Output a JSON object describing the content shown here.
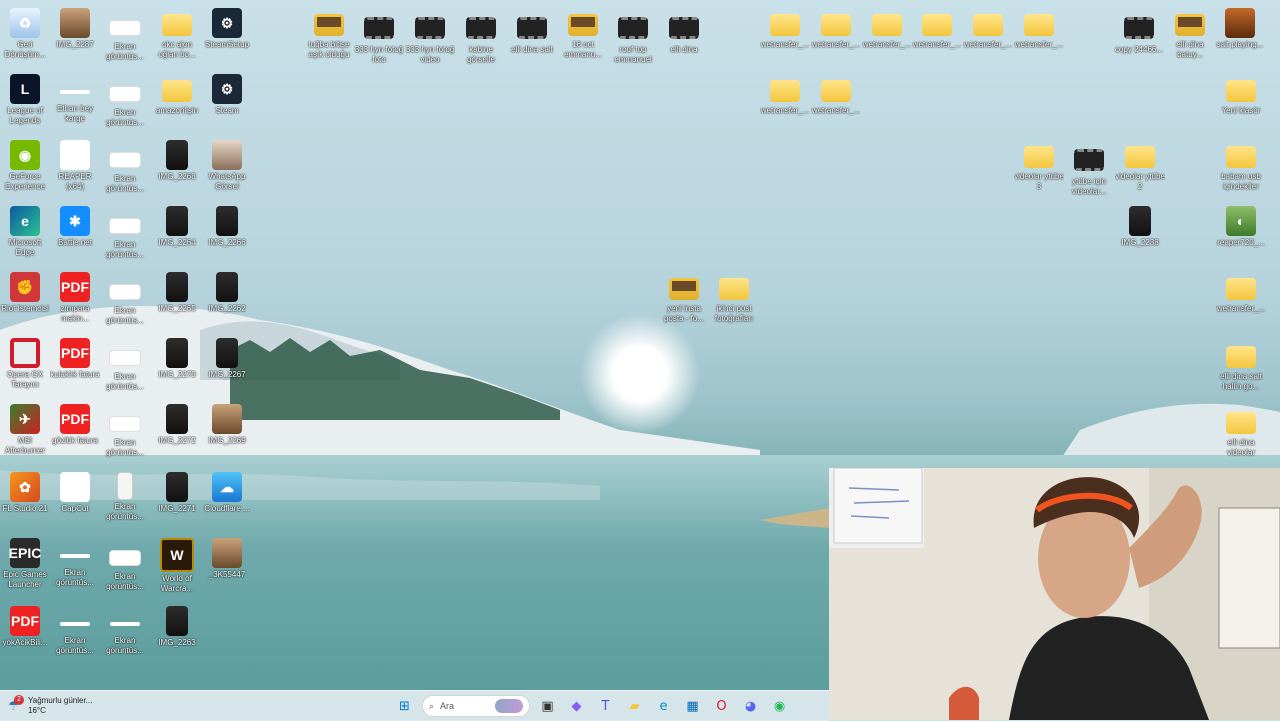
{
  "desktop": {
    "icons": [
      {
        "label": "Geri Dönüşüm...",
        "icon": "recycle-bin-icon",
        "style": "g-recycle",
        "glyph": "♻"
      },
      {
        "label": "IMG_2287",
        "icon": "photo-file-icon",
        "style": "g-person",
        "glyph": ""
      },
      {
        "label": "Ekran görüntüs...",
        "icon": "screenshot-file-icon",
        "style": "g-screen",
        "glyph": ""
      },
      {
        "label": "okc ajon oğlan bo...",
        "icon": "folder-icon",
        "style": "g-folder",
        "glyph": ""
      },
      {
        "label": "SteamSetup",
        "icon": "steam-icon",
        "style": "g-steam",
        "glyph": "⚙"
      },
      {
        "label": "League of Legends",
        "icon": "league-of-legends-icon",
        "style": "g-lol",
        "glyph": "L"
      },
      {
        "label": "Ethan bey karge",
        "icon": "screenshot-file-icon",
        "style": "g-strip",
        "glyph": ""
      },
      {
        "label": "Ekran görüntüs...",
        "icon": "screenshot-file-icon",
        "style": "g-screen",
        "glyph": ""
      },
      {
        "label": "amazonlişin",
        "icon": "folder-icon",
        "style": "g-folder",
        "glyph": ""
      },
      {
        "label": "Steam",
        "icon": "steam-icon",
        "style": "g-steam",
        "glyph": "⚙"
      },
      {
        "label": "GeForce Experience",
        "icon": "nvidia-icon",
        "style": "g-nvidia",
        "glyph": "◉"
      },
      {
        "label": "REAPER (x64)",
        "icon": "reaper-icon",
        "style": "g-reaper",
        "glyph": "◐"
      },
      {
        "label": "Ekran görüntüs...",
        "icon": "screenshot-file-icon",
        "style": "g-screen",
        "glyph": ""
      },
      {
        "label": "IMG_2268",
        "icon": "photo-file-icon",
        "style": "g-photo",
        "glyph": ""
      },
      {
        "label": "WhatsApp Görsel 2023...",
        "icon": "photo-file-icon",
        "style": "g-wa",
        "glyph": ""
      },
      {
        "label": "Microsoft Edge",
        "icon": "edge-icon",
        "style": "g-edge",
        "glyph": "e"
      },
      {
        "label": "Battle.net",
        "icon": "battlenet-icon",
        "style": "g-bnet",
        "glyph": "✱"
      },
      {
        "label": "Ekran görüntüs...",
        "icon": "screenshot-file-icon",
        "style": "g-screen",
        "glyph": ""
      },
      {
        "label": "IMG_2264",
        "icon": "photo-file-icon",
        "style": "g-photo",
        "glyph": ""
      },
      {
        "label": "IMG_2266",
        "icon": "photo-file-icon",
        "style": "g-photo",
        "glyph": ""
      },
      {
        "label": "Riot İstemcisi",
        "icon": "riot-icon",
        "style": "g-riot",
        "glyph": "✊"
      },
      {
        "label": "zımpara makin...",
        "icon": "pdf-file-icon",
        "style": "g-pdf",
        "glyph": "PDF"
      },
      {
        "label": "Ekran görüntüs...",
        "icon": "screenshot-file-icon",
        "style": "g-screen",
        "glyph": ""
      },
      {
        "label": "IMG_2265",
        "icon": "photo-file-icon",
        "style": "g-photo",
        "glyph": ""
      },
      {
        "label": "IMG_2262",
        "icon": "photo-file-icon",
        "style": "g-photo",
        "glyph": ""
      },
      {
        "label": "Opera GX Tarayıcı",
        "icon": "opera-gx-icon",
        "style": "g-opera",
        "glyph": ""
      },
      {
        "label": "kulaklık fatura",
        "icon": "pdf-file-icon",
        "style": "g-pdf",
        "glyph": "PDF"
      },
      {
        "label": "Ekran görüntüs...",
        "icon": "screenshot-file-icon",
        "style": "g-screen",
        "glyph": ""
      },
      {
        "label": "IMG_2270",
        "icon": "photo-file-icon",
        "style": "g-photo",
        "glyph": ""
      },
      {
        "label": "IMG_2267",
        "icon": "photo-file-icon",
        "style": "g-photo",
        "glyph": ""
      },
      {
        "label": "MSI Afterburner",
        "icon": "msi-afterburner-icon",
        "style": "g-msi",
        "glyph": "✈"
      },
      {
        "label": "gözlük fatura",
        "icon": "pdf-file-icon",
        "style": "g-pdf",
        "glyph": "PDF"
      },
      {
        "label": "Ekran görüntüs...",
        "icon": "screenshot-file-icon",
        "style": "g-screen",
        "glyph": ""
      },
      {
        "label": "IMG_2272",
        "icon": "photo-file-icon",
        "style": "g-photo",
        "glyph": ""
      },
      {
        "label": "IMG_2269",
        "icon": "photo-file-icon",
        "style": "g-person",
        "glyph": ""
      },
      {
        "label": "FL Studio 21",
        "icon": "fl-studio-icon",
        "style": "g-fl",
        "glyph": "✿"
      },
      {
        "label": "CapCut",
        "icon": "capcut-icon",
        "style": "g-capcut",
        "glyph": "✂"
      },
      {
        "label": "Ekran görüntüs...",
        "icon": "screenshot-file-icon",
        "style": "g-file",
        "glyph": ""
      },
      {
        "label": "IMG_2271",
        "icon": "photo-file-icon",
        "style": "g-photo",
        "glyph": ""
      },
      {
        "label": "Cloudflare ...",
        "icon": "cloudflare-icon",
        "style": "g-cloud",
        "glyph": "☁"
      },
      {
        "label": "Epic Games Launcher",
        "icon": "epic-games-icon",
        "style": "g-epic",
        "glyph": "EPIC"
      },
      {
        "label": "Ekran görüntüs...",
        "icon": "screenshot-file-icon",
        "style": "g-strip",
        "glyph": ""
      },
      {
        "label": "Ekran görüntüs...",
        "icon": "screenshot-file-icon",
        "style": "g-screen",
        "glyph": ""
      },
      {
        "label": "World of Warcra...",
        "icon": "world-of-warcraft-icon",
        "style": "g-wow",
        "glyph": "W"
      },
      {
        "label": "_3K55447",
        "icon": "photo-file-icon",
        "style": "g-person",
        "glyph": ""
      },
      {
        "label": "yokAcikBili...",
        "icon": "pdf-file-icon",
        "style": "g-pdf",
        "glyph": "PDF"
      },
      {
        "label": "Ekran görüntüs...",
        "icon": "screenshot-file-icon",
        "style": "g-strip",
        "glyph": ""
      },
      {
        "label": "Ekran görüntüs...",
        "icon": "screenshot-file-icon",
        "style": "g-strip",
        "glyph": ""
      },
      {
        "label": "IMG_2263",
        "icon": "photo-file-icon",
        "style": "g-photo",
        "glyph": ""
      },
      {
        "label": "tuğba bitişe aşık olduğu",
        "icon": "video-folder-icon",
        "style": "g-folderimg",
        "glyph": ""
      },
      {
        "label": "333 hyn fotoğ foto",
        "icon": "video-folder-icon",
        "style": "g-film",
        "glyph": ""
      },
      {
        "label": "333 hyn fotoğ video",
        "icon": "video-folder-icon",
        "style": "g-film",
        "glyph": ""
      },
      {
        "label": "kabine görselle",
        "icon": "video-folder-icon",
        "style": "g-film",
        "glyph": ""
      },
      {
        "label": "elli dina salt",
        "icon": "video-folder-icon",
        "style": "g-film",
        "glyph": ""
      },
      {
        "label": "16 oct emmanu...",
        "icon": "video-folder-icon",
        "style": "g-folderimg",
        "glyph": ""
      },
      {
        "label": "roof top emmanuel",
        "icon": "video-folder-icon",
        "style": "g-film",
        "glyph": ""
      },
      {
        "label": "elli dina",
        "icon": "video-folder-icon",
        "style": "g-film",
        "glyph": ""
      },
      {
        "label": "wetransfer_...",
        "icon": "zip-folder-icon",
        "style": "g-folder",
        "glyph": ""
      },
      {
        "label": "wetransfer_...",
        "icon": "zip-folder-icon",
        "style": "g-folder",
        "glyph": ""
      },
      {
        "label": "wetransfer_...",
        "icon": "zip-folder-icon",
        "style": "g-folder",
        "glyph": ""
      },
      {
        "label": "wetransfer_...",
        "icon": "zip-folder-icon",
        "style": "g-folder",
        "glyph": ""
      },
      {
        "label": "wetransfer_...",
        "icon": "zip-folder-icon",
        "style": "g-folder",
        "glyph": ""
      },
      {
        "label": "wetransfer_...",
        "icon": "zip-folder-icon",
        "style": "g-folder",
        "glyph": ""
      },
      {
        "label": "wetransfer_...",
        "icon": "zip-folder-icon",
        "style": "g-folder",
        "glyph": ""
      },
      {
        "label": "wetransfer_...",
        "icon": "zip-folder-icon",
        "style": "g-folder",
        "glyph": ""
      },
      {
        "label": "copy 24466...",
        "icon": "video-file-icon",
        "style": "g-film",
        "glyph": ""
      },
      {
        "label": "elli dina batuy...",
        "icon": "video-folder-icon",
        "style": "g-folderimg",
        "glyph": ""
      },
      {
        "label": "salt playing...",
        "icon": "photo-file-icon",
        "style": "g-game",
        "glyph": ""
      },
      {
        "label": "Yeni klasör",
        "icon": "folder-icon",
        "style": "g-folder",
        "glyph": ""
      },
      {
        "label": "videolar ytübe 3",
        "icon": "folder-icon",
        "style": "g-folder",
        "glyph": ""
      },
      {
        "label": "ytübe için videolar...",
        "icon": "video-folder-icon",
        "style": "g-film",
        "glyph": ""
      },
      {
        "label": "videolar ytübe 2",
        "icon": "folder-icon",
        "style": "g-folder",
        "glyph": ""
      },
      {
        "label": "babam usb içindekiler",
        "icon": "folder-icon",
        "style": "g-folder",
        "glyph": ""
      },
      {
        "label": "IMG_2238",
        "icon": "photo-file-icon",
        "style": "g-photo",
        "glyph": ""
      },
      {
        "label": "reaper720_...",
        "icon": "archive-file-icon",
        "style": "g-rar",
        "glyph": "◐"
      },
      {
        "label": "yeni insta posta - fo...",
        "icon": "video-folder-icon",
        "style": "g-folderimg",
        "glyph": ""
      },
      {
        "label": "ikinci post fotoğrafları",
        "icon": "folder-icon",
        "style": "g-folder",
        "glyph": ""
      },
      {
        "label": "wetransfer_...",
        "icon": "zip-folder-icon",
        "style": "g-folder",
        "glyph": ""
      },
      {
        "label": "elli dina salt hallin go...",
        "icon": "zip-folder-icon",
        "style": "g-folder",
        "glyph": ""
      },
      {
        "label": "elli dina videolar",
        "icon": "zip-folder-icon",
        "style": "g-folder",
        "glyph": ""
      }
    ]
  },
  "taskbar": {
    "weather": {
      "title": "Yağmurlu günler...",
      "temp": "16°C",
      "badge": "2"
    },
    "search_placeholder": "Ara",
    "apps": [
      {
        "name": "start-button",
        "icon": "windows-icon",
        "glyph": "⊞",
        "color": "#0078d4"
      },
      {
        "name": "task-view-button",
        "icon": "task-view-icon",
        "glyph": "▣",
        "color": "#333333"
      },
      {
        "name": "copilot-button",
        "icon": "copilot-icon",
        "glyph": "◆",
        "color": "#8a5cf6"
      },
      {
        "name": "teams-button",
        "icon": "teams-icon",
        "glyph": "T",
        "color": "#5059c9"
      },
      {
        "name": "file-explorer-button",
        "icon": "folder-icon",
        "glyph": "▰",
        "color": "#f3c63d"
      },
      {
        "name": "edge-button",
        "icon": "edge-icon",
        "glyph": "e",
        "color": "#0c89d4"
      },
      {
        "name": "store-button",
        "icon": "store-icon",
        "glyph": "▦",
        "color": "#0066b4"
      },
      {
        "name": "opera-gx-button",
        "icon": "opera-gx-icon",
        "glyph": "O",
        "color": "#d01c2c"
      },
      {
        "name": "discord-button",
        "icon": "discord-icon",
        "glyph": "◕",
        "color": "#5865f2"
      },
      {
        "name": "spotify-button",
        "icon": "spotify-icon",
        "glyph": "◉",
        "color": "#1db954"
      }
    ]
  }
}
